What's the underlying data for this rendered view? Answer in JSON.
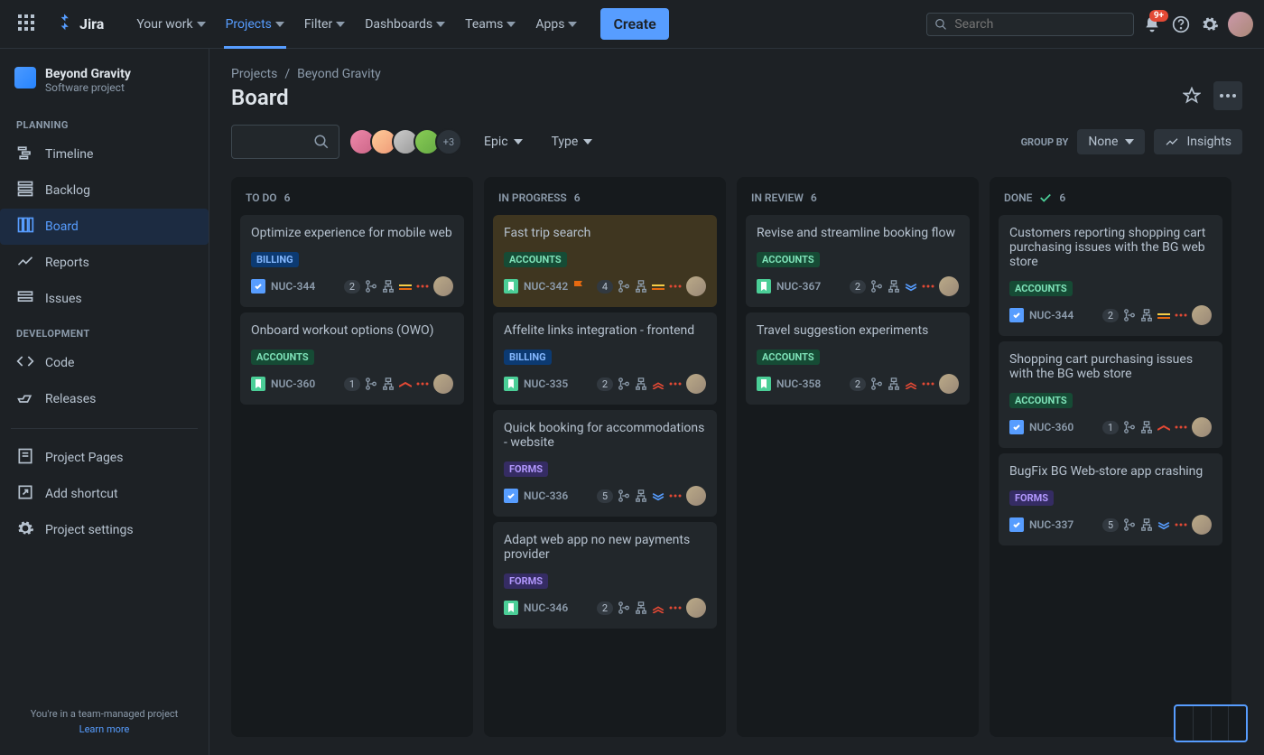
{
  "topbar": {
    "logo": "Jira",
    "nav": [
      "Your work",
      "Projects",
      "Filter",
      "Dashboards",
      "Teams",
      "Apps"
    ],
    "nav_active_index": 1,
    "create": "Create",
    "search_placeholder": "Search",
    "notif_count": "9+"
  },
  "sidebar": {
    "project_name": "Beyond Gravity",
    "project_sub": "Software project",
    "planning_label": "PLANNING",
    "planning": [
      "Timeline",
      "Backlog",
      "Board",
      "Reports",
      "Issues"
    ],
    "planning_active_index": 2,
    "development_label": "DEVELOPMENT",
    "development": [
      "Code",
      "Releases"
    ],
    "other": [
      "Project Pages",
      "Add shortcut",
      "Project settings"
    ],
    "footer_line": "You're in a team-managed project",
    "footer_link": "Learn more"
  },
  "breadcrumb": [
    "Projects",
    "Beyond Gravity"
  ],
  "page_title": "Board",
  "toolbar": {
    "avatar_more": "+3",
    "epic": "Epic",
    "type": "Type",
    "groupby_label": "GROUP BY",
    "groupby_value": "None",
    "insights": "Insights"
  },
  "columns": [
    {
      "name": "TO DO",
      "count": "6",
      "done": false,
      "cards": [
        {
          "title": "Optimize experience for mobile web",
          "tag": "BILLING",
          "tag_cls": "tag-blue",
          "issue": "task",
          "key": "NUC-344",
          "count": "2",
          "prio": "medium",
          "hl": false
        },
        {
          "title": "Onboard workout options (OWO)",
          "tag": "ACCOUNTS",
          "tag_cls": "tag-green",
          "issue": "story",
          "key": "NUC-360",
          "count": "1",
          "prio": "high",
          "hl": false
        }
      ]
    },
    {
      "name": "IN PROGRESS",
      "count": "6",
      "done": false,
      "cards": [
        {
          "title": "Fast trip search",
          "tag": "ACCOUNTS",
          "tag_cls": "tag-green",
          "issue": "story",
          "key": "NUC-342",
          "count": "4",
          "prio": "medium",
          "hl": true,
          "flag": true
        },
        {
          "title": "Affelite links integration - frontend",
          "tag": "BILLING",
          "tag_cls": "tag-blue",
          "issue": "story",
          "key": "NUC-335",
          "count": "2",
          "prio": "highest",
          "hl": false
        },
        {
          "title": "Quick booking for accommodations - website",
          "tag": "FORMS",
          "tag_cls": "tag-purple",
          "issue": "task",
          "key": "NUC-336",
          "count": "5",
          "prio": "low",
          "hl": false
        },
        {
          "title": "Adapt web app no new payments provider",
          "tag": "FORMS",
          "tag_cls": "tag-purple",
          "issue": "story",
          "key": "NUC-346",
          "count": "2",
          "prio": "highest",
          "hl": false
        }
      ]
    },
    {
      "name": "IN REVIEW",
      "count": "6",
      "done": false,
      "cards": [
        {
          "title": "Revise and streamline booking flow",
          "tag": "ACCOUNTS",
          "tag_cls": "tag-green",
          "issue": "story",
          "key": "NUC-367",
          "count": "2",
          "prio": "low",
          "hl": false
        },
        {
          "title": "Travel suggestion experiments",
          "tag": "ACCOUNTS",
          "tag_cls": "tag-green",
          "issue": "story",
          "key": "NUC-358",
          "count": "2",
          "prio": "highest",
          "hl": false
        }
      ]
    },
    {
      "name": "DONE",
      "count": "6",
      "done": true,
      "cards": [
        {
          "title": "Customers reporting shopping cart purchasing issues with the BG web store",
          "tag": "ACCOUNTS",
          "tag_cls": "tag-green",
          "issue": "task",
          "key": "NUC-344",
          "count": "2",
          "prio": "medium",
          "hl": false
        },
        {
          "title": "Shopping cart purchasing issues with the BG web store",
          "tag": "ACCOUNTS",
          "tag_cls": "tag-green",
          "issue": "task",
          "key": "NUC-360",
          "count": "1",
          "prio": "high",
          "hl": false
        },
        {
          "title": "BugFix BG Web-store app crashing",
          "tag": "FORMS",
          "tag_cls": "tag-purple",
          "issue": "task",
          "key": "NUC-337",
          "count": "5",
          "prio": "low",
          "hl": false
        }
      ]
    }
  ]
}
